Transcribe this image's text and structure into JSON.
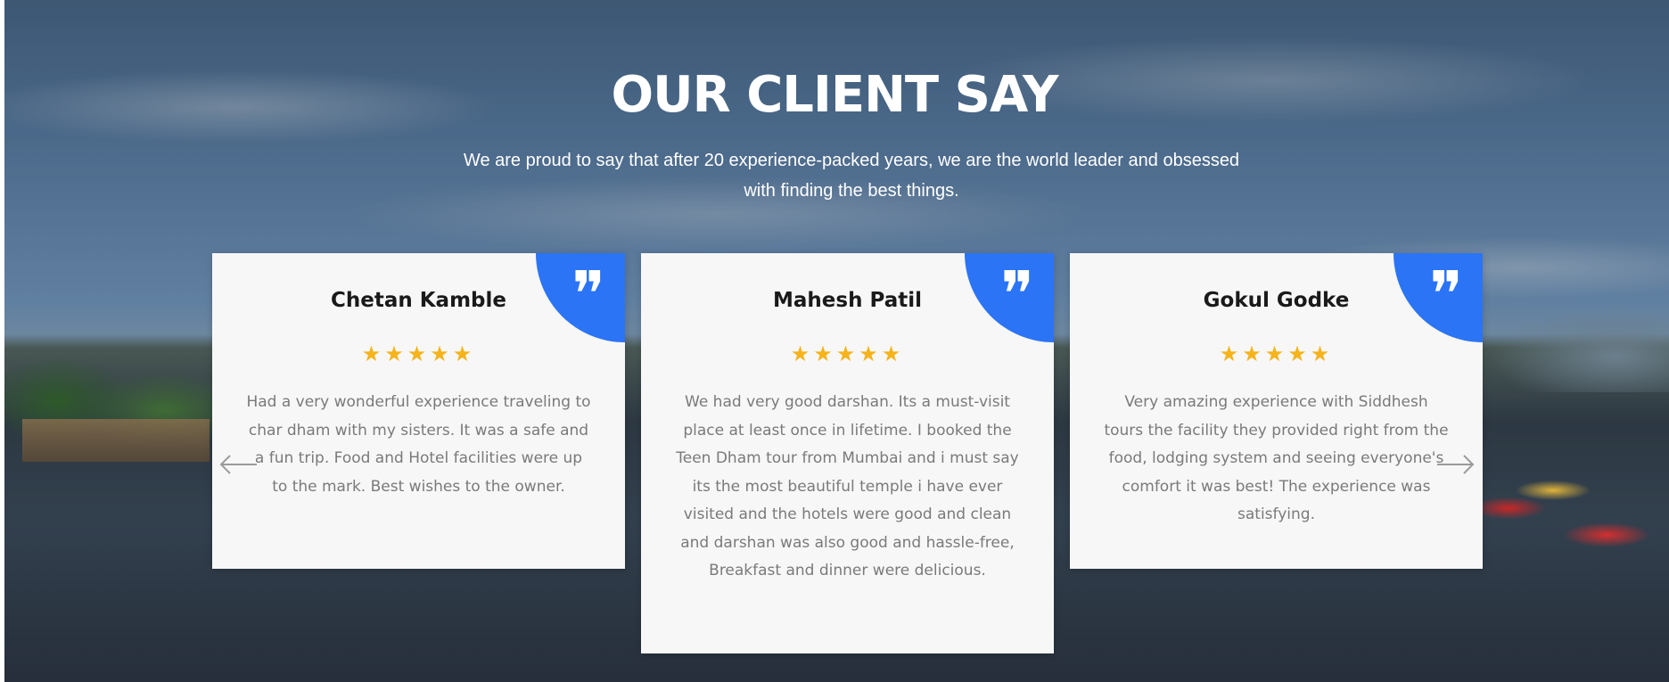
{
  "section": {
    "title": "OUR CLIENT SAY",
    "subtitle": "We are proud to say that after 20 experience-packed years, we are the world leader and obsessed with finding the best things."
  },
  "colors": {
    "accent": "#2b74f6",
    "star": "#f5b31c",
    "card_background": "#f7f7f7",
    "review_text": "#7a7a7a"
  },
  "testimonials": [
    {
      "name": "Chetan Kamble",
      "rating": 5,
      "stars": "★★★★★",
      "review": "Had a very wonderful experience traveling to char dham with my sisters. It was a safe and a fun trip. Food and Hotel facilities were up to the mark. Best wishes to the owner."
    },
    {
      "name": "Mahesh Patil",
      "rating": 5,
      "stars": "★★★★★",
      "review": "We had very good darshan. Its a must-visit place at least once in lifetime. I booked the Teen Dham tour from Mumbai and i must say its the most beautiful temple i have ever visited and the hotels were good and clean and darshan was also good and hassle-free, Breakfast and dinner were delicious."
    },
    {
      "name": "Gokul Godke",
      "rating": 5,
      "stars": "★★★★★",
      "review": "Very amazing experience with Siddhesh tours the facility they provided right from the food, lodging system and seeing everyone's comfort it was best! The experience was satisfying."
    }
  ],
  "icons": {
    "quote": "quote-icon",
    "star": "star-icon",
    "prev": "arrow-left-icon",
    "next": "arrow-right-icon"
  }
}
